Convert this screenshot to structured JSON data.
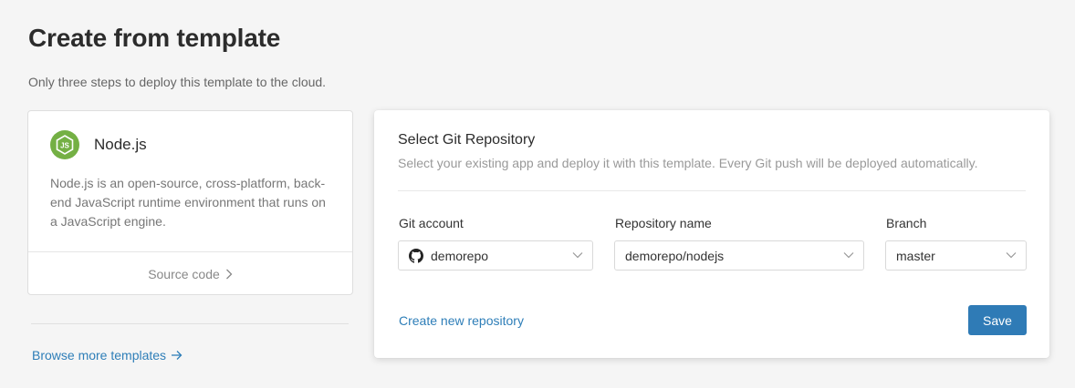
{
  "page": {
    "title": "Create from template",
    "subtitle": "Only three steps to deploy this template to the cloud."
  },
  "template": {
    "icon": "nodejs-logo",
    "name": "Node.js",
    "description": "Node.js is an open-source, cross-platform, back-end JavaScript runtime environment that runs on a JavaScript engine.",
    "source_link": "Source code",
    "logo_text": "JS",
    "logo_color": "#74b044"
  },
  "browse_link": "Browse more templates",
  "repo_form": {
    "title": "Select Git Repository",
    "description": "Select your existing app and deploy it with this template. Every Git push will be deployed automatically.",
    "git_account": {
      "label": "Git account",
      "value": "demorepo",
      "icon": "github-icon"
    },
    "repository": {
      "label": "Repository name",
      "value": "demorepo/nodejs"
    },
    "branch": {
      "label": "Branch",
      "value": "master"
    },
    "create_link": "Create new repository",
    "save_label": "Save"
  },
  "colors": {
    "accent": "#2f7bb6",
    "link": "#2e7eb8"
  }
}
